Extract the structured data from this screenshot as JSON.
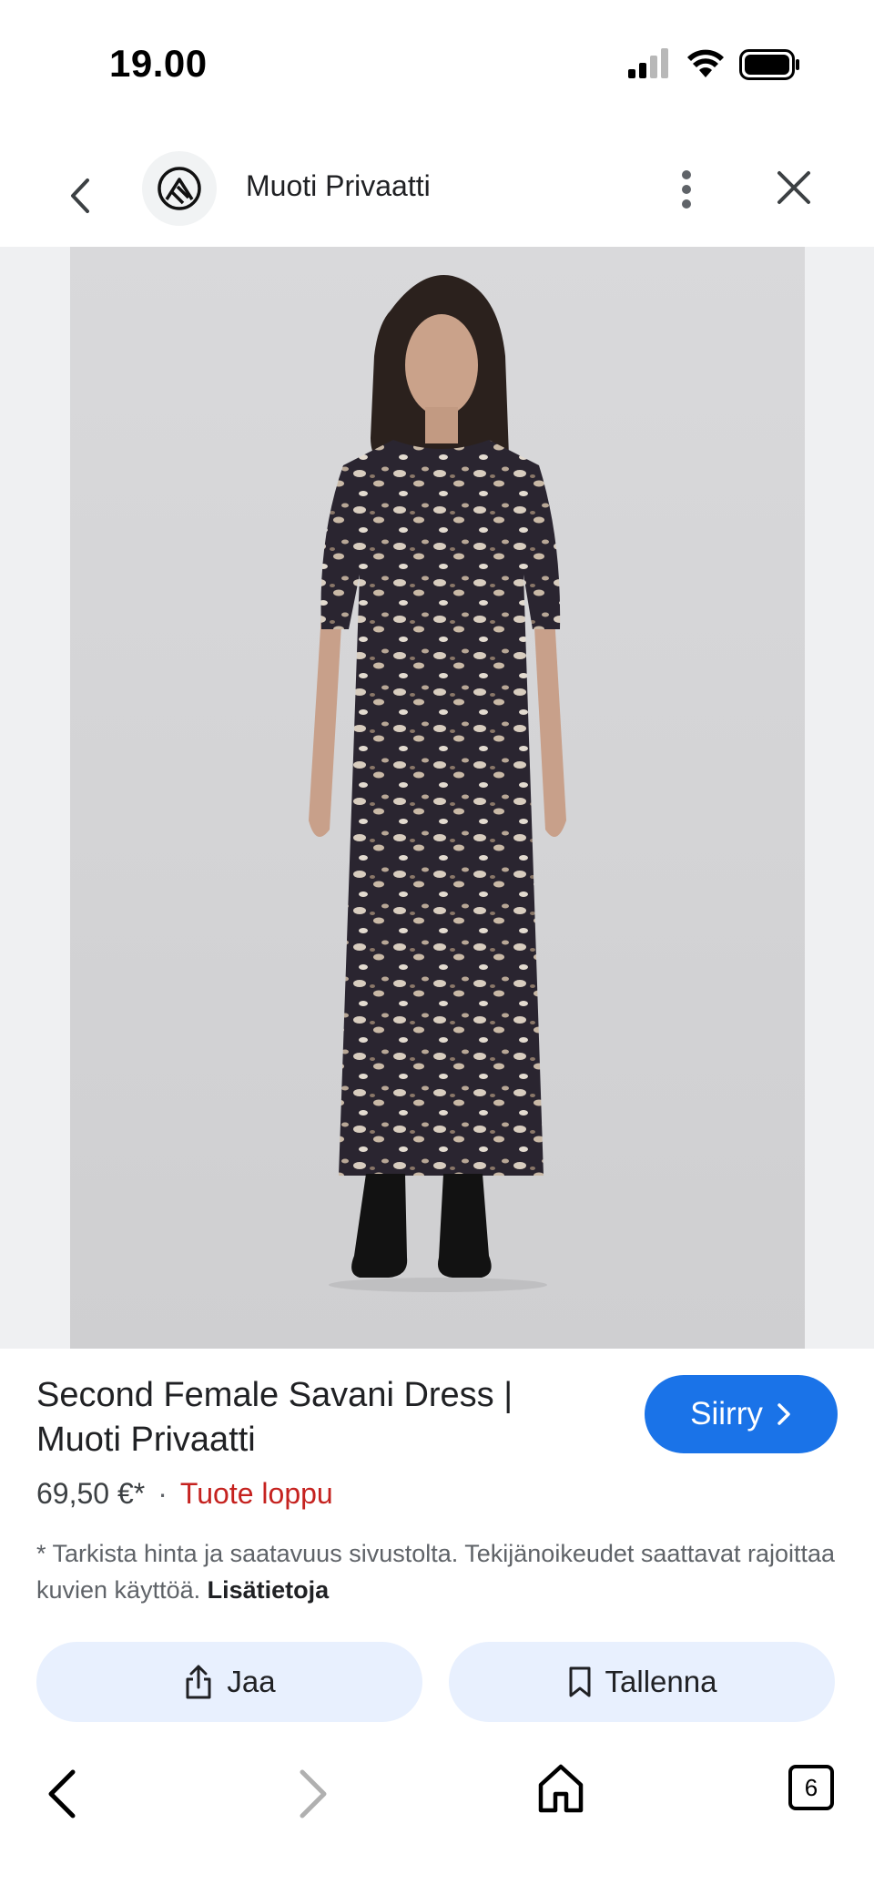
{
  "status_bar": {
    "time": "19.00",
    "icons": [
      "signal-icon",
      "wifi-icon",
      "battery-icon"
    ]
  },
  "app_bar": {
    "site_name": "Muoti Privaatti",
    "icons": [
      "back-arrow-icon",
      "site-logo-icon",
      "more-vert-icon",
      "close-icon"
    ]
  },
  "product": {
    "image_alt": "Second Female Savani Dress",
    "title": "Second Female Savani Dress | Muoti Privaatti",
    "go_button_label": "Siirry",
    "price": "69,50 €*",
    "separator": "·",
    "availability": "Tuote loppu",
    "disclaimer": "* Tarkista hinta ja saatavuus sivustolta. Tekijänoikeudet saattavat rajoittaa kuvien käyttöä.",
    "more_info_link": "Lisätietoja"
  },
  "actions": {
    "share_label": "Jaa",
    "save_label": "Tallenna"
  },
  "bottom_nav": {
    "tab_count": "6",
    "icons": [
      "nav-back-icon",
      "nav-forward-icon",
      "home-icon",
      "tabs-icon"
    ]
  },
  "colors": {
    "accent": "#1a73e8",
    "action_bg": "#e8f0fe",
    "out_of_stock": "#c5221f",
    "image_bg": "#eff0f2"
  }
}
